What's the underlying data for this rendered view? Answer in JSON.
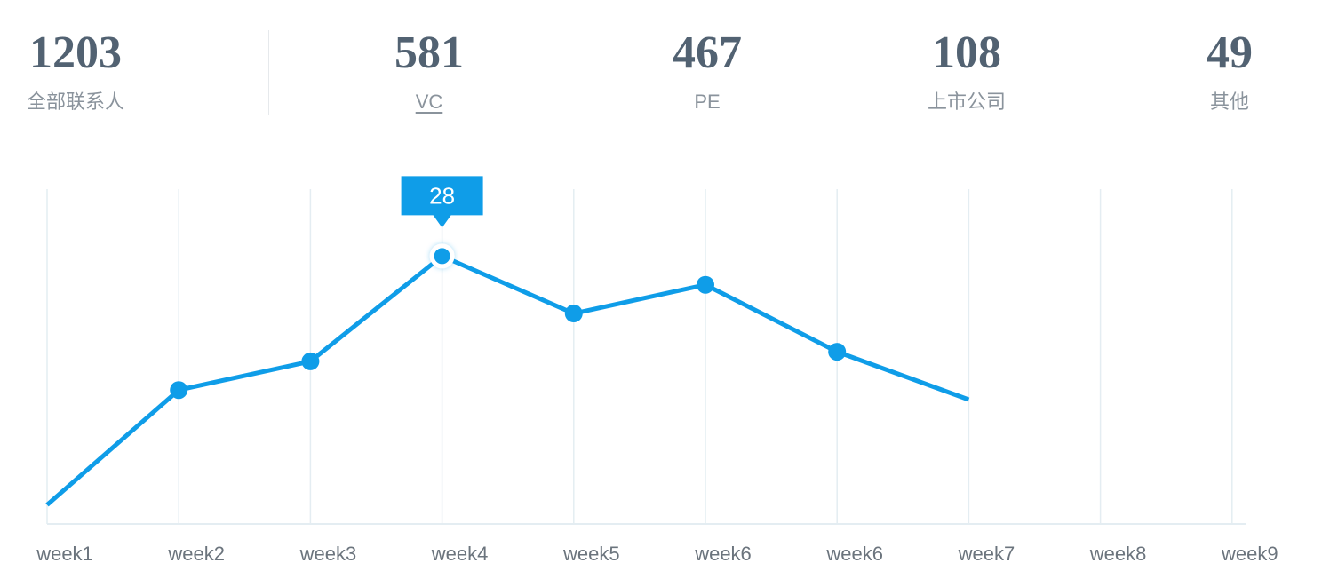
{
  "stats": [
    {
      "value": "1203",
      "label": "全部联系人"
    },
    {
      "value": "581",
      "label": "VC"
    },
    {
      "value": "467",
      "label": "PE"
    },
    {
      "value": "108",
      "label": "上市公司"
    },
    {
      "value": "49",
      "label": "其他"
    }
  ],
  "colors": {
    "line": "#0f9de8",
    "grid": "#e4edf2",
    "number": "#526272",
    "label": "#8a939c"
  },
  "chart_data": {
    "type": "line",
    "categories": [
      "week1",
      "week2",
      "week3",
      "week4",
      "week5",
      "week6",
      "week6",
      "week7",
      "week8",
      "week9"
    ],
    "series": [
      {
        "values": [
          2,
          14,
          17,
          28,
          22,
          25,
          18,
          13,
          null,
          null
        ]
      }
    ],
    "ylim": [
      0,
      35
    ],
    "grid": {
      "vertical": true,
      "horizontal": false
    },
    "tooltip": {
      "category_index": 3,
      "value": "28"
    }
  }
}
